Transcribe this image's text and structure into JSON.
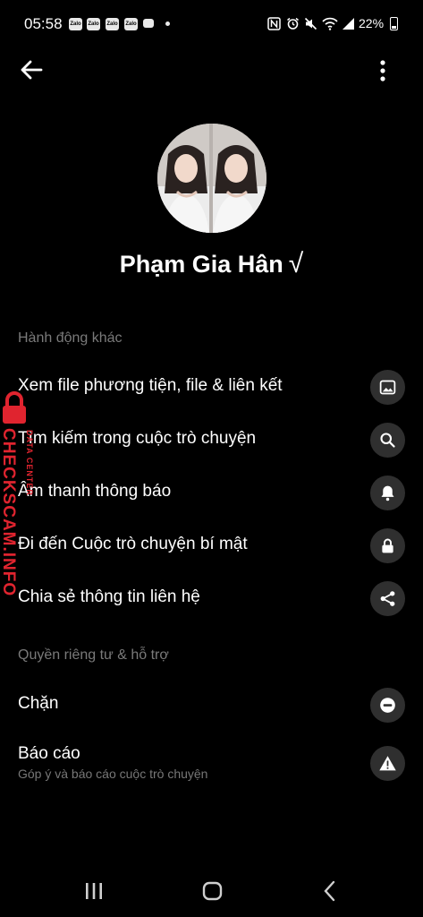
{
  "status_bar": {
    "time": "05:58",
    "app_icons": [
      "Zalo",
      "Zalo",
      "Zalo",
      "Zalo"
    ],
    "battery": "22%"
  },
  "header": {
    "back_icon": "arrow-left-icon",
    "more_icon": "more-vertical-icon"
  },
  "profile": {
    "name": "Phạm Gia Hân",
    "verified_mark": "√"
  },
  "sections": [
    {
      "title": "Hành động khác",
      "items": [
        {
          "label": "Xem file phương tiện, file & liên kết",
          "icon": "image-icon"
        },
        {
          "label": "Tìm kiếm trong cuộc trò chuyện",
          "icon": "search-icon"
        },
        {
          "label": "Âm thanh thông báo",
          "icon": "bell-icon"
        },
        {
          "label": "Đi đến Cuộc trò chuyện bí mật",
          "icon": "lock-icon"
        },
        {
          "label": "Chia sẻ thông tin liên hệ",
          "icon": "share-icon"
        }
      ]
    },
    {
      "title": "Quyền riêng tư & hỗ trợ",
      "items": [
        {
          "label": "Chặn",
          "icon": "block-icon"
        },
        {
          "label": "Báo cáo",
          "sublabel": "Góp ý và báo cáo cuộc trò chuyện",
          "icon": "warning-icon"
        }
      ]
    }
  ],
  "watermark": {
    "text": "CHECKSCAM.INFO",
    "subtext": "DATA CENTER",
    "color": "#e0242f"
  },
  "colors": {
    "background": "#000000",
    "icon_circle": "#2f2f2f",
    "section_title": "#7a7a7a"
  }
}
